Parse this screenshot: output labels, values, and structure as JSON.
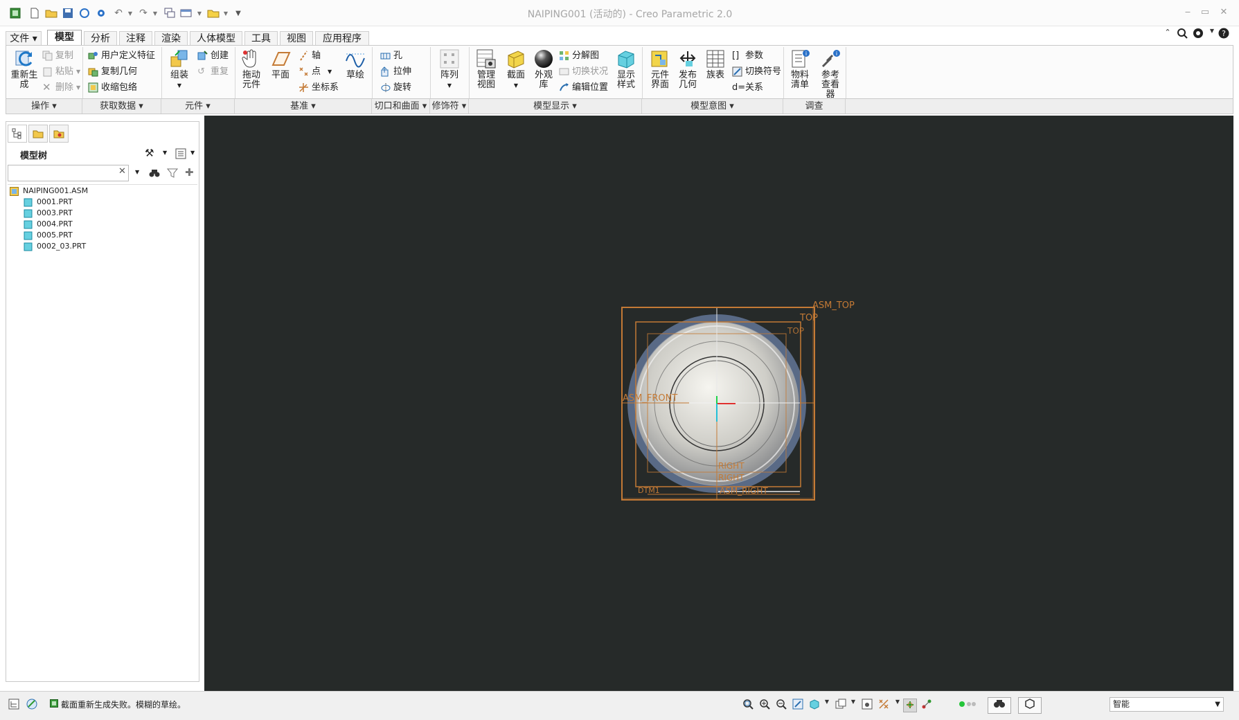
{
  "window": {
    "title": "NAIPING001 (活动的) - Creo Parametric 2.0"
  },
  "quick_access": [
    "app-icon",
    "new-icon",
    "open-icon",
    "save-icon",
    "regenerate-icon",
    "settings-icon",
    "undo-icon",
    "redo-icon",
    "windows-icon",
    "close-window-icon",
    "folder-icon",
    "customize-icon"
  ],
  "menu": {
    "tabs": [
      {
        "label": "文件"
      },
      {
        "label": "模型"
      },
      {
        "label": "分析"
      },
      {
        "label": "注释"
      },
      {
        "label": "渲染"
      },
      {
        "label": "人体模型"
      },
      {
        "label": "工具"
      },
      {
        "label": "视图"
      },
      {
        "label": "应用程序"
      }
    ],
    "active_tab": "模型"
  },
  "ribbon": {
    "operations": {
      "regenerate": "重新生成",
      "copy": "复制",
      "paste": "粘贴",
      "delete": "删除"
    },
    "get_data": {
      "user_defined_feature": "用户定义特征",
      "copy_geometry": "复制几何",
      "shrinkwrap": "收缩包络"
    },
    "component": {
      "assemble": "组装",
      "create": "创建",
      "repeat": "重复"
    },
    "datum": {
      "drag_component": "拖动元件",
      "plane": "平面",
      "axis": "轴",
      "point": "点",
      "coordinate_system": "坐标系",
      "sketch": "草绘"
    },
    "cut_surface": {
      "hole": "孔",
      "extrude": "拉伸",
      "revolve": "旋转"
    },
    "modifiers": {
      "pattern": "阵列"
    },
    "model_display": {
      "manage_views": "管理视图",
      "section": "截面",
      "appearance_gallery": "外观库",
      "exploded_view": "分解图",
      "toggle_status": "切换状况",
      "edit_position": "编辑位置",
      "display_style": "显示样式"
    },
    "model_intent": {
      "component_interface": "元件界面",
      "publish_geometry": "发布几何",
      "family_table": "族表",
      "parameters": "参数",
      "switch_symbols": "切换符号",
      "relations": "关系"
    },
    "investigate": {
      "bill_of_materials": "物料清单",
      "reference_viewer": "参考查看器"
    }
  },
  "groups": [
    {
      "label": "操作"
    },
    {
      "label": "获取数据"
    },
    {
      "label": "元件"
    },
    {
      "label": "基准"
    },
    {
      "label": "切口和曲面"
    },
    {
      "label": "修饰符"
    },
    {
      "label": "模型显示"
    },
    {
      "label": "模型意图"
    },
    {
      "label": "调查"
    }
  ],
  "model_tree": {
    "title": "模型树",
    "search_value": "",
    "root": "NAIPING001.ASM",
    "items": [
      "0001.PRT",
      "0003.PRT",
      "0004.PRT",
      "0005.PRT",
      "0002_03.PRT"
    ]
  },
  "viewport": {
    "background": "#262a29",
    "datum_color": "#c47a35",
    "labels": {
      "asm_top": "ASM_TOP",
      "top1": "TOP",
      "top2": "TOP",
      "asm_front": "ASM_FRONT",
      "right1": "RIGHT",
      "right2": "RIGHT",
      "asm_right": "ASM_RIGHT",
      "dtm": "DTM1"
    }
  },
  "status": {
    "message": "截面重新生成失败。模糊的草绘。",
    "selection_filter": "智能"
  }
}
